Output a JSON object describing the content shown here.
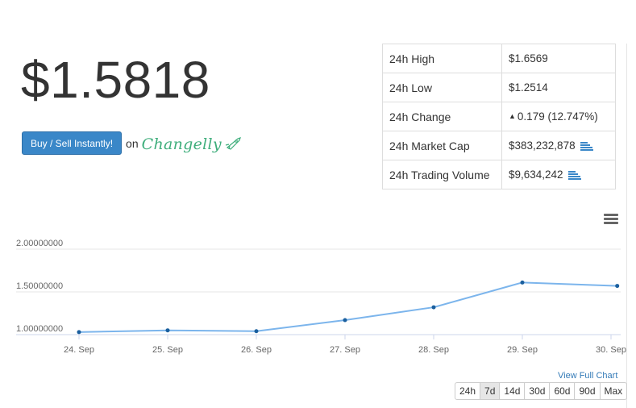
{
  "price": "$1.5818",
  "buy_button_label": "Buy / Sell Instantly!",
  "on_text": "on",
  "partner_logo_text": "Changelly",
  "stats": [
    {
      "label": "24h High",
      "value": "$1.6569"
    },
    {
      "label": "24h Low",
      "value": "$1.2514"
    },
    {
      "label": "24h Change",
      "value": "0.179 (12.747%)",
      "direction": "up"
    },
    {
      "label": "24h Market Cap",
      "value": "$383,232,878",
      "icon": "list-icon"
    },
    {
      "label": "24h Trading Volume",
      "value": "$9,634,242",
      "icon": "list-icon"
    }
  ],
  "colors": {
    "accent": "#3a87c8",
    "positive": "#5cb85c",
    "line": "#7cb5ec",
    "marker": "#1a5f9e",
    "link": "#337ab7"
  },
  "chart_menu_icon": "hamburger-menu-icon",
  "chart_data": {
    "type": "line",
    "categories": [
      "24. Sep",
      "25. Sep",
      "26. Sep",
      "27. Sep",
      "28. Sep",
      "29. Sep",
      "30. Sep"
    ],
    "x": [
      0,
      1,
      2,
      3,
      4,
      5,
      6.07
    ],
    "series": [
      {
        "values": [
          1.03,
          1.05,
          1.04,
          1.17,
          1.32,
          1.61,
          1.57
        ]
      }
    ],
    "y_ticks": [
      "1.00000000",
      "1.50000000",
      "2.00000000"
    ],
    "y_tick_values": [
      1.0,
      1.5,
      2.0
    ],
    "ylim": [
      1.0,
      2.0
    ],
    "grid": true
  },
  "view_full_chart_label": "View Full Chart",
  "range_buttons": [
    "24h",
    "7d",
    "14d",
    "30d",
    "60d",
    "90d",
    "Max"
  ],
  "active_range": "7d"
}
